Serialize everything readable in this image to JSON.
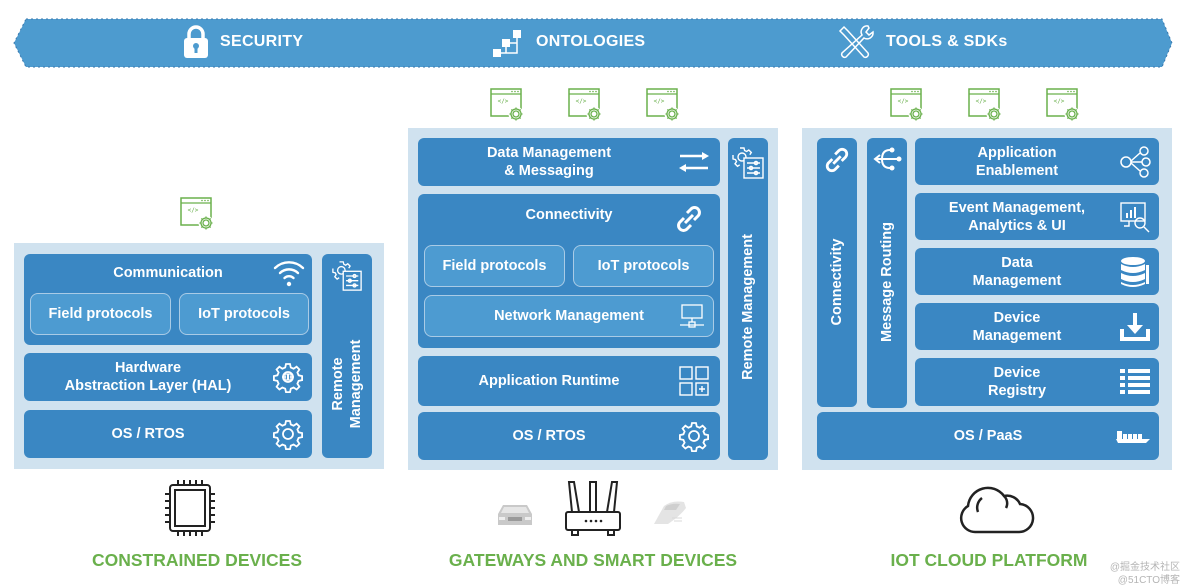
{
  "banner": {
    "items": [
      {
        "label": "SECURITY",
        "icon": "lock-icon"
      },
      {
        "label": "ONTOLOGIES",
        "icon": "hierarchy-icon"
      },
      {
        "label": "TOOLS & SDKs",
        "icon": "tools-icon"
      }
    ],
    "color": "#4d9bcf"
  },
  "constrained": {
    "caption": "CONSTRAINED DEVICES",
    "device_icon": "chip-icon",
    "app_icons": 1,
    "communication": {
      "label": "Communication",
      "icon": "wifi-icon",
      "subs": [
        "Field protocols",
        "IoT protocols"
      ]
    },
    "hal": {
      "line1": "Hardware",
      "line2": "Abstraction Layer (HAL)",
      "icon": "hal-gear-icon"
    },
    "os": {
      "label": "OS / RTOS",
      "icon": "gear-icon"
    },
    "remote": {
      "line1": "Remote",
      "line2": "Management",
      "icon": "remote-settings-icon"
    }
  },
  "gateways": {
    "caption": "GATEWAYS AND SMART DEVICES",
    "device_icons": [
      "car-icon",
      "router-icon",
      "train-icon"
    ],
    "app_icons": 3,
    "data_mgmt": {
      "line1": "Data Management",
      "line2": "& Messaging",
      "icon": "arrows-exchange-icon"
    },
    "connectivity": {
      "label": "Connectivity",
      "icon": "link-icon",
      "subs": [
        "Field protocols",
        "IoT protocols"
      ],
      "network": "Network Management"
    },
    "runtime": {
      "label": "Application Runtime",
      "icon": "app-grid-icon"
    },
    "os": {
      "label": "OS / RTOS",
      "icon": "gear-icon"
    },
    "remote": {
      "label": "Remote Management",
      "icon": "remote-settings-icon"
    }
  },
  "cloud": {
    "caption": "IOT CLOUD PLATFORM",
    "device_icon": "cloud-icon",
    "app_icons": 3,
    "connectivity": {
      "label": "Connectivity",
      "icon": "link-icon"
    },
    "routing": {
      "label": "Message Routing",
      "icon": "routing-icon"
    },
    "stack": [
      {
        "line1": "Application",
        "line2": "Enablement",
        "icon": "share-nodes-icon"
      },
      {
        "line1": "Event Management,",
        "line2": "Analytics & UI",
        "icon": "analytics-icon"
      },
      {
        "line1": "Data",
        "line2": "Management",
        "icon": "database-icon"
      },
      {
        "line1": "Device",
        "line2": "Management",
        "icon": "download-icon"
      },
      {
        "line1": "Device",
        "line2": "Registry",
        "icon": "list-icon"
      }
    ],
    "os": {
      "label": "OS / PaaS",
      "icon": "ship-icon"
    }
  },
  "watermark": {
    "line1": "@掘金技术社区",
    "line2": "@51CTO博客"
  }
}
